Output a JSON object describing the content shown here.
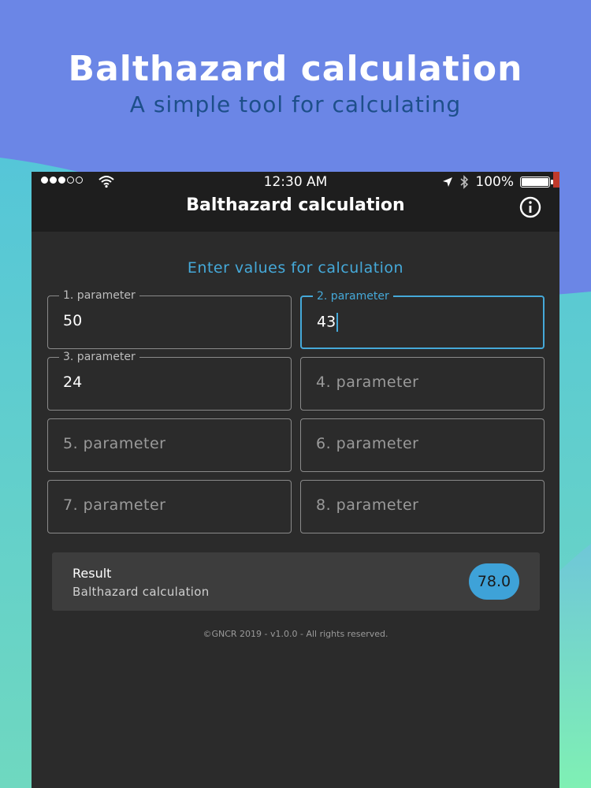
{
  "promo": {
    "title": "Balthazard calculation",
    "subtitle": "A simple tool for calculating"
  },
  "status_bar": {
    "time": "12:30 AM",
    "battery": "100%",
    "icons": [
      "signal-dots-icon",
      "wifi-icon",
      "location-arrow-icon",
      "bluetooth-icon",
      "battery-icon"
    ]
  },
  "nav": {
    "title": "Balthazard calculation",
    "info_icon": "info-icon"
  },
  "form": {
    "heading": "Enter values for calculation",
    "fields": [
      {
        "label": "1. parameter",
        "value": "50"
      },
      {
        "label": "2. parameter",
        "value": "43",
        "focused": true
      },
      {
        "label": "3. parameter",
        "value": "24"
      },
      {
        "label": "4. parameter",
        "value": ""
      },
      {
        "label": "5. parameter",
        "value": ""
      },
      {
        "label": "6. parameter",
        "value": ""
      },
      {
        "label": "7. parameter",
        "value": ""
      },
      {
        "label": "8. parameter",
        "value": ""
      }
    ]
  },
  "result": {
    "title": "Result",
    "subtitle": "Balthazard calculation",
    "value": "78.0"
  },
  "footer": {
    "text": "©GNCR 2019 - v1.0.0 - All rights reserved."
  },
  "colors": {
    "accent": "#45a9d9",
    "background_top": "#6b86e6",
    "background_teal": "#5ec8d6",
    "background_green": "#7ee8b0",
    "app_dark": "#2b2b2b"
  }
}
